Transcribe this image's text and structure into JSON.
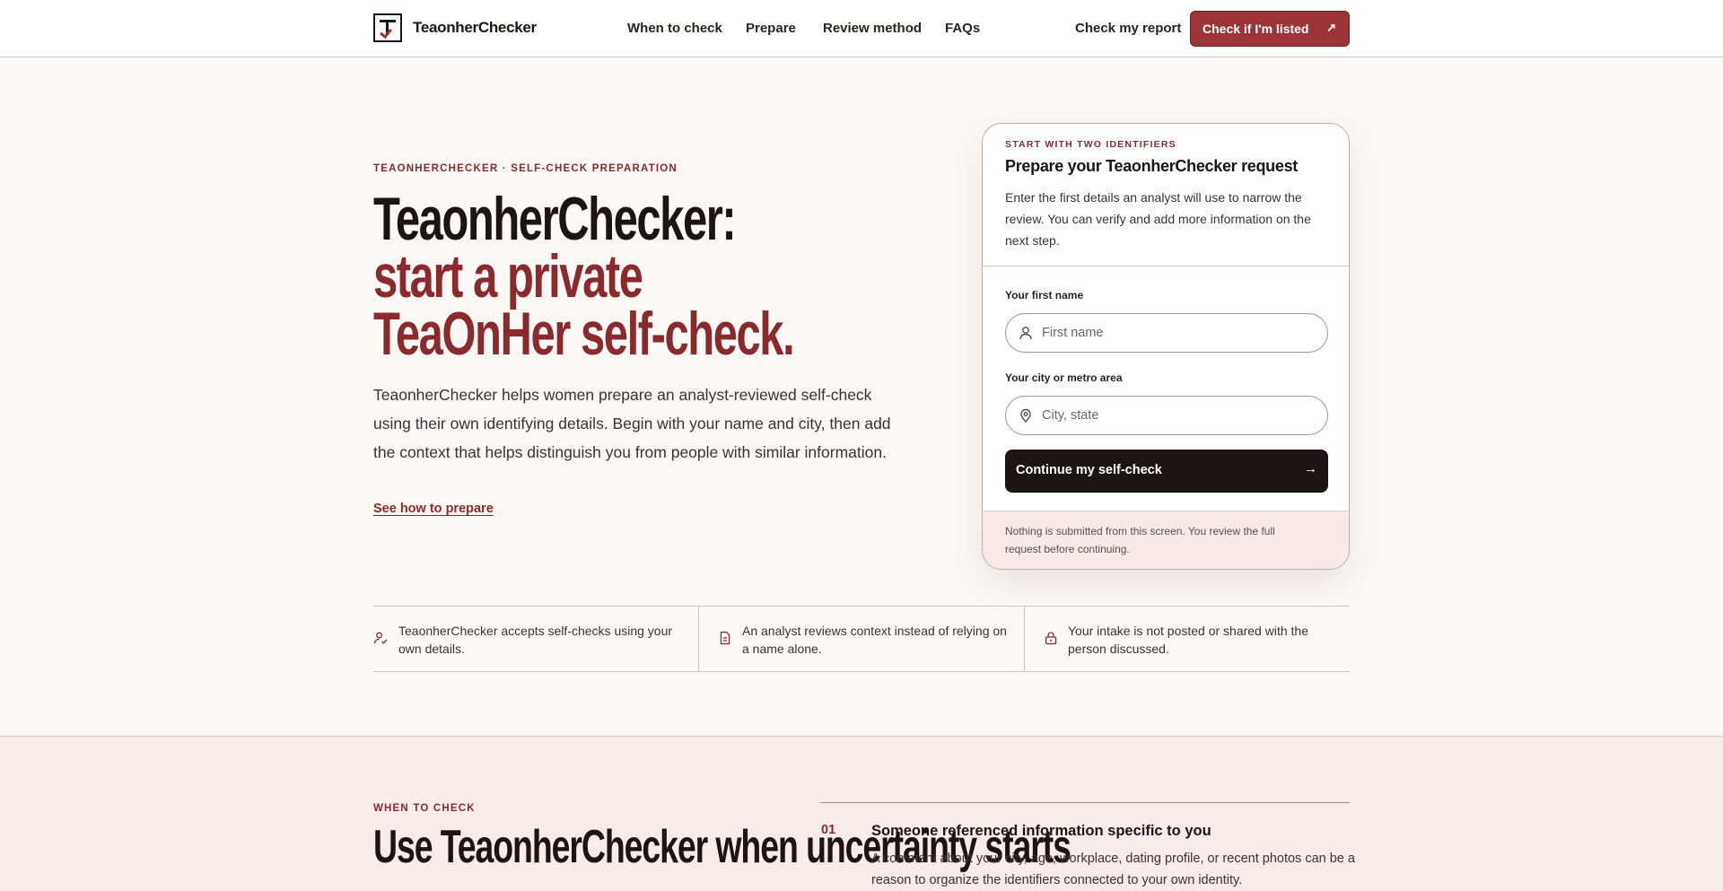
{
  "header": {
    "brand": "TeaonherChecker",
    "nav": [
      "When to check",
      "Prepare",
      "Review method",
      "FAQs"
    ],
    "report_link": "Check my report",
    "cta_label": "Check if I'm listed"
  },
  "hero": {
    "eyebrow": "TEAONHERCHECKER · SELF-CHECK PREPARATION",
    "title_line1": "TeaonherChecker:",
    "title_line2": "start a private",
    "title_line3": "TeaOnHer self-check.",
    "body": "TeaonherChecker helps women prepare an analyst-reviewed self-check using their own identifying details. Begin with your name and city, then add the context that helps distinguish you from people with similar information.",
    "link": "See how to prepare"
  },
  "card": {
    "eyebrow": "START WITH TWO IDENTIFIERS",
    "title": "Prepare your TeaonherChecker request",
    "description": "Enter the first details an analyst will use to narrow the review. You can verify and add more information on the next step.",
    "first_name_label": "Your first name",
    "first_name_placeholder": "First name",
    "first_name_value": "",
    "city_label": "Your city or metro area",
    "city_placeholder": "City, state",
    "city_value": "",
    "continue_label": "Continue my self-check",
    "footnote": "Nothing is submitted from this screen. You review the full request before continuing."
  },
  "features": [
    {
      "icon": "user-check-icon",
      "text": "TeaonherChecker accepts self-checks using your own details."
    },
    {
      "icon": "document-icon",
      "text": "An analyst reviews context instead of relying on a name alone."
    },
    {
      "icon": "lock-icon",
      "text": "Your intake is not posted or shared with the person discussed."
    }
  ],
  "when_to_check": {
    "eyebrow": "WHEN TO CHECK",
    "title": "Use TeaonherChecker when uncertainty starts",
    "item_number": "01",
    "item_title": "Someone referenced information specific to you",
    "item_body": "A comment about your city, age, workplace, dating profile, or recent photos can be a reason to organize the identifiers connected to your own identity."
  },
  "colors": {
    "accent": "#8a2a2d",
    "cta_background": "#9b3537",
    "dark": "#1d1414",
    "page_background": "#fcf9f7",
    "section_background": "#f8ecea"
  }
}
